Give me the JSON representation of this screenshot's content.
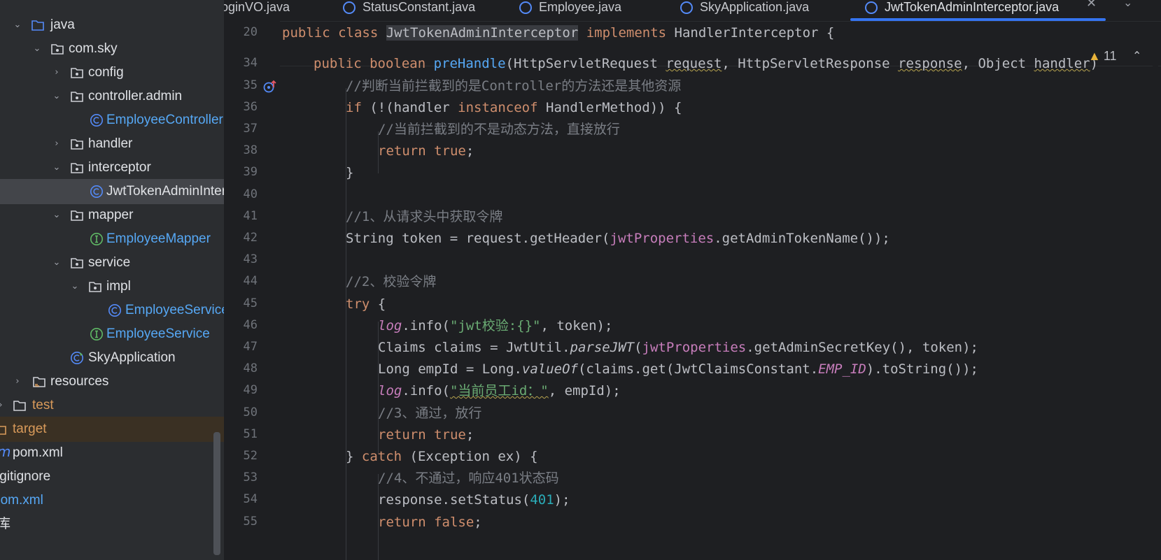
{
  "tree": {
    "items": [
      {
        "label": "java",
        "level": "folder",
        "expanded": true,
        "color": "normal"
      },
      {
        "label": "com.sky",
        "expanded": true
      },
      {
        "label": "config",
        "expanded": false
      },
      {
        "label": "controller.admin",
        "expanded": true
      },
      {
        "label": "EmployeeController",
        "kind": "class"
      },
      {
        "label": "handler",
        "expanded": false
      },
      {
        "label": "interceptor",
        "expanded": true
      },
      {
        "label": "JwtTokenAdminInterceptor",
        "kind": "class",
        "selected": true
      },
      {
        "label": "mapper",
        "expanded": true
      },
      {
        "label": "EmployeeMapper",
        "kind": "interface"
      },
      {
        "label": "service",
        "expanded": true
      },
      {
        "label": "impl",
        "expanded": true
      },
      {
        "label": "EmployeeServiceImpl",
        "kind": "class"
      },
      {
        "label": "EmployeeService",
        "kind": "interface"
      },
      {
        "label": "SkyApplication",
        "kind": "app"
      },
      {
        "label": "resources",
        "expanded": false
      },
      {
        "label": "test"
      },
      {
        "label": "target"
      },
      {
        "label": "pom.xml"
      },
      {
        "label": ".gitignore"
      },
      {
        "label": "pom.xml"
      },
      {
        "label": "库"
      }
    ]
  },
  "tabs": [
    {
      "label": "LoginVO.java"
    },
    {
      "label": "StatusConstant.java"
    },
    {
      "label": "Employee.java"
    },
    {
      "label": "SkyApplication.java"
    },
    {
      "label": "JwtTokenAdminInterceptor.java",
      "active": true
    }
  ],
  "editor": {
    "warnings_count": "11",
    "line_numbers": [
      "20",
      "34",
      "35",
      "36",
      "37",
      "38",
      "39",
      "40",
      "41",
      "42",
      "43",
      "44",
      "45",
      "46",
      "47",
      "48",
      "49",
      "50",
      "51",
      "52",
      "53",
      "54",
      "55"
    ],
    "lines": {
      "l20": {
        "kw_public": "public class ",
        "cls": "JwtTokenAdminInterceptor",
        "impl": " implements ",
        "iface": "HandlerInterceptor {"
      },
      "l34": {
        "a": "public boolean ",
        "fn": "preHandle",
        "b": "(HttpServletRequest ",
        "p1": "request",
        "c": ", HttpServletResponse ",
        "p2": "response",
        "d": ", Object ",
        "p3": "handler",
        "e": ")"
      },
      "l35": {
        "t": "//判断当前拦截到的是Controller的方法还是其他资源"
      },
      "l36": {
        "a": "if ",
        "b": "(!(handler ",
        "kw": "instanceof",
        "c": " HandlerMethod)) {"
      },
      "l37": {
        "t": "//当前拦截到的不是动态方法，直接放行"
      },
      "l38": {
        "kw": "return true",
        "t": ";"
      },
      "l39": {
        "t": "}"
      },
      "l41": {
        "t": "//1、从请求头中获取令牌"
      },
      "l42": {
        "a": "String token = request.getHeader(",
        "f": "jwtProperties",
        "b": ".getAdminTokenName());"
      },
      "l44": {
        "t": "//2、校验令牌"
      },
      "l45": {
        "kw": "try",
        "t": " {"
      },
      "l46": {
        "f": "log",
        "a": ".info(",
        "s": "\"jwt校验:{}\"",
        "b": ", token);"
      },
      "l47": {
        "a": "Claims claims = JwtUtil.",
        "m": "parseJWT",
        "b": "(",
        "f": "jwtProperties",
        "c": ".getAdminSecretKey(), token);"
      },
      "l48": {
        "a": "Long empId = Long.",
        "m": "valueOf",
        "b": "(claims.get(JwtClaimsConstant.",
        "sf": "EMP_ID",
        "c": ").toString());"
      },
      "l49": {
        "f": "log",
        "a": ".info(",
        "s": "\"当前员工id：\"",
        "b": ", empId);"
      },
      "l50": {
        "t": "//3、通过，放行"
      },
      "l51": {
        "kw": "return true",
        "t": ";"
      },
      "l52": {
        "a": "} ",
        "kw": "catch",
        "b": " (Exception ex) {"
      },
      "l53": {
        "t": "//4、不通过，响应401状态码"
      },
      "l54": {
        "a": "response.setStatus(",
        "n": "401",
        "b": ");"
      },
      "l55": {
        "kw": "return false",
        "t": ";"
      }
    }
  }
}
